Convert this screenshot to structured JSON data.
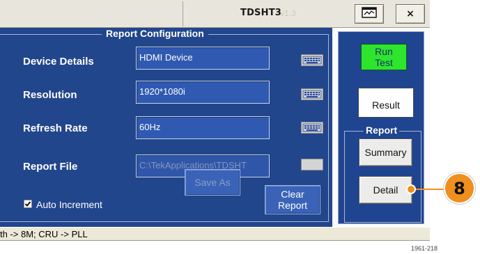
{
  "window": {
    "title": "TDSHT3",
    "version": "v1.3",
    "minimize_icon": "restore-window-icon",
    "close_label": "×"
  },
  "report_config": {
    "title": "Report Configuration",
    "fields": [
      {
        "label": "Device Details",
        "value": "HDMI Device",
        "enabled": true
      },
      {
        "label": "Resolution",
        "value": "1920*1080i",
        "enabled": true
      },
      {
        "label": "Refresh Rate",
        "value": "60Hz",
        "enabled": true
      },
      {
        "label": "Report File",
        "value": "C:\\TekApplications\\TDSHT",
        "enabled": false
      }
    ],
    "keyboard_icon": "keyboard-icon",
    "auto_increment": {
      "label": "Auto Increment",
      "checked": true
    },
    "save_as_label": "Save As",
    "clear_report_label": [
      "Clear",
      "Report"
    ]
  },
  "side_panel": {
    "run_test_label": [
      "Run",
      "Test"
    ],
    "result_label": "Result",
    "report_title": "Report",
    "summary_label": "Summary",
    "detail_label": "Detail"
  },
  "callout": {
    "number": "8",
    "color": "#ef8f1e"
  },
  "status": {
    "text": "th -> 8M; CRU -> PLL"
  },
  "figure_id": "1961-218",
  "colors": {
    "panel": "#22468c",
    "input": "#305ab1",
    "run_button": "#2ee52e",
    "titlebar": "#e8e6dc"
  }
}
